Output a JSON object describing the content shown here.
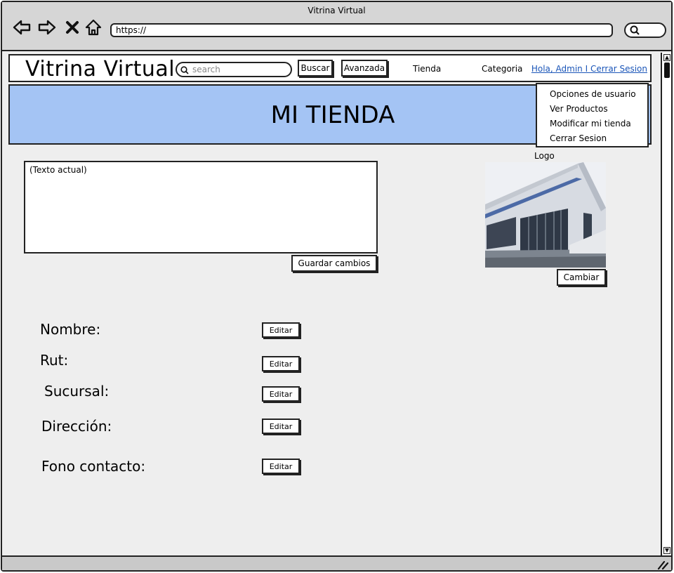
{
  "window": {
    "title": "Vitrina Virtual"
  },
  "browser": {
    "url": "https://"
  },
  "site": {
    "brand": "Vitrina Virtual",
    "search_placeholder": "search",
    "buscar_label": "Buscar",
    "avanzada_label": "Avanzada",
    "nav": {
      "tienda": "Tienda",
      "categoria": "Categoria"
    },
    "user_link": "Hola, Admin I Cerrar Sesion"
  },
  "banner": {
    "title": "MI TIENDA"
  },
  "user_menu": {
    "items": [
      "Opciones de usuario",
      "Ver Productos",
      "Modificar mi tienda",
      "Cerrar Sesion"
    ]
  },
  "description": {
    "text": "(Texto actual)",
    "save_label": "Guardar cambios"
  },
  "logo": {
    "label": "Logo",
    "change_label": "Cambiar"
  },
  "fields": [
    {
      "label": "Nombre:",
      "edit_label": "Editar"
    },
    {
      "label": "Rut:",
      "edit_label": "Editar"
    },
    {
      "label": "Sucursal:",
      "edit_label": "Editar"
    },
    {
      "label": "Dirección:",
      "edit_label": "Editar"
    },
    {
      "label": "Fono contacto:",
      "edit_label": "Editar"
    }
  ],
  "colors": {
    "banner": "#a4c4f4",
    "link": "#1a55b8",
    "chrome": "#d6d6d6",
    "page": "#eeeeee"
  },
  "icons": [
    "back-arrow-icon",
    "forward-arrow-icon",
    "close-x-icon",
    "home-icon",
    "search-icon",
    "resize-grip-icon"
  ]
}
